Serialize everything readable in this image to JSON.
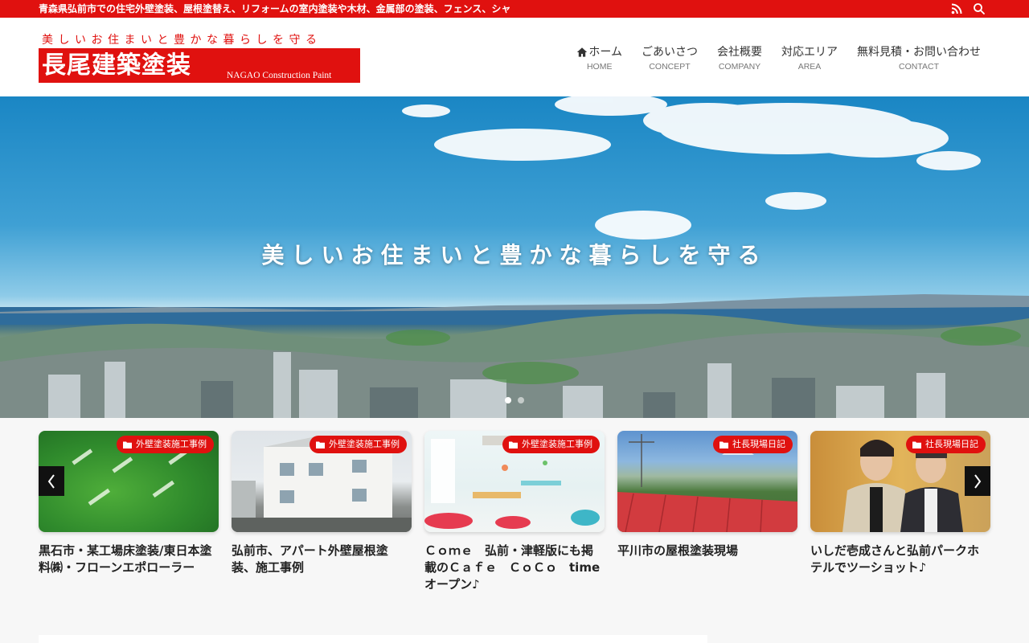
{
  "topbar": {
    "tagline": "青森県弘前市での住宅外壁塗装、屋根塗替え、リフォームの室内塗装や木材、金属部の塗装、フェンス、シャ",
    "icons": [
      "rss-icon",
      "search-icon"
    ]
  },
  "logo": {
    "slogan": "美しいお住まいと豊かな暮らしを守る",
    "name": "長尾建築塗装",
    "sub": "NAGAO Construction Paint"
  },
  "nav": [
    {
      "jp": "ホーム",
      "en": "HOME",
      "icon": "home-icon"
    },
    {
      "jp": "ごあいさつ",
      "en": "CONCEPT"
    },
    {
      "jp": "会社概要",
      "en": "COMPANY"
    },
    {
      "jp": "対応エリア",
      "en": "AREA"
    },
    {
      "jp": "無料見積・お問い合わせ",
      "en": "CONTACT"
    }
  ],
  "hero": {
    "headline": "美しいお住まいと豊かな暮らしを守る",
    "slide_count": 2,
    "active_slide": 1
  },
  "cards": [
    {
      "category": "外壁塗装施工事例",
      "title": "黒石市・某工場床塗装/東日本塗料㈱・フローンエポローラー"
    },
    {
      "category": "外壁塗装施工事例",
      "title": "弘前市、アパート外壁屋根塗装、施工事例"
    },
    {
      "category": "外壁塗装施工事例",
      "title": "Ｃｏｍｅ　弘前・津軽版にも掲載のＣａｆｅ　ＣｏＣｏ　time オープン♪"
    },
    {
      "category": "社長現場日記",
      "title": "平川市の屋根塗装現場"
    },
    {
      "category": "社長現場日記",
      "title": "いしだ壱成さんと弘前パークホテルでツーショット♪"
    }
  ],
  "colors": {
    "brand_red": "#e0110f",
    "text": "#333333"
  }
}
